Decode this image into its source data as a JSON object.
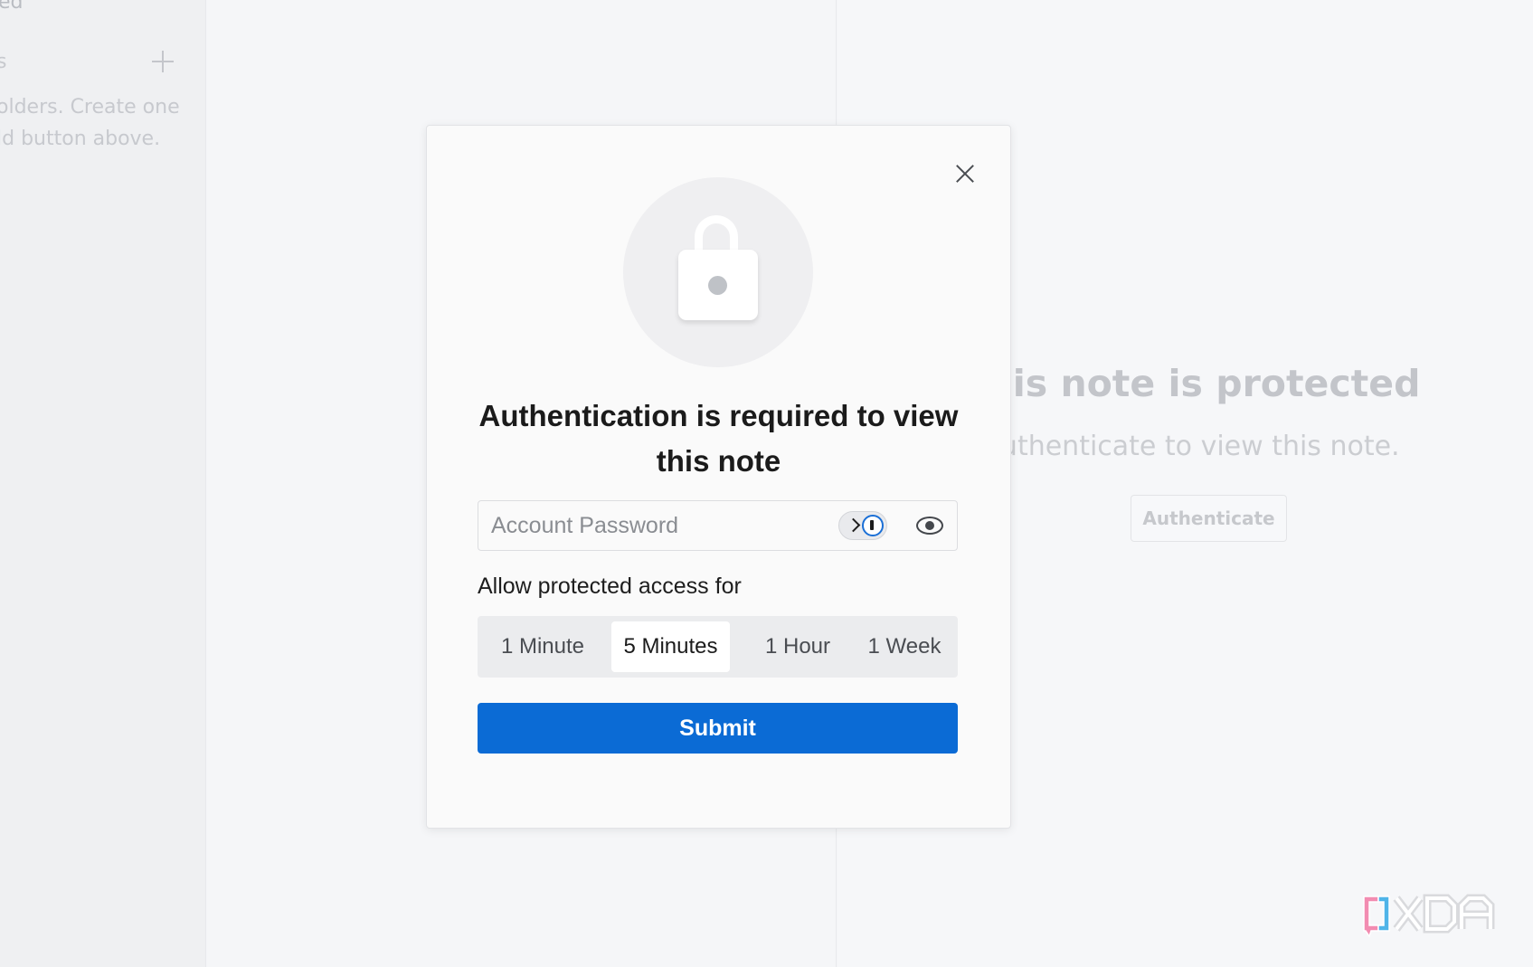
{
  "sidebar": {
    "top_text": "ed",
    "section_label": "s",
    "empty_lines": [
      "olders. Create one",
      "ld button above."
    ]
  },
  "editor": {
    "title": "This note is protected",
    "subtitle": "Authenticate to view this note.",
    "authenticate_label": "Authenticate"
  },
  "modal": {
    "title": "Authentication is required to view this note",
    "password": {
      "value": "",
      "placeholder": "Account Password"
    },
    "access_label": "Allow protected access for",
    "durations": [
      "1 Minute",
      "5 Minutes",
      "1 Hour",
      "1 Week"
    ],
    "selected_duration": "5 Minutes",
    "submit_label": "Submit"
  },
  "colors": {
    "accent": "#0b6bd5",
    "onepassword_blue": "#1a6fd6",
    "xda_pink": "#f28cb1",
    "xda_blue": "#4fb4e8"
  },
  "icons": {
    "sidebar_add": "plus-icon",
    "close": "close-icon",
    "lock": "lock-icon",
    "password_manager": "onepassword-icon",
    "reveal": "eye-icon",
    "watermark": "xda-logo"
  }
}
